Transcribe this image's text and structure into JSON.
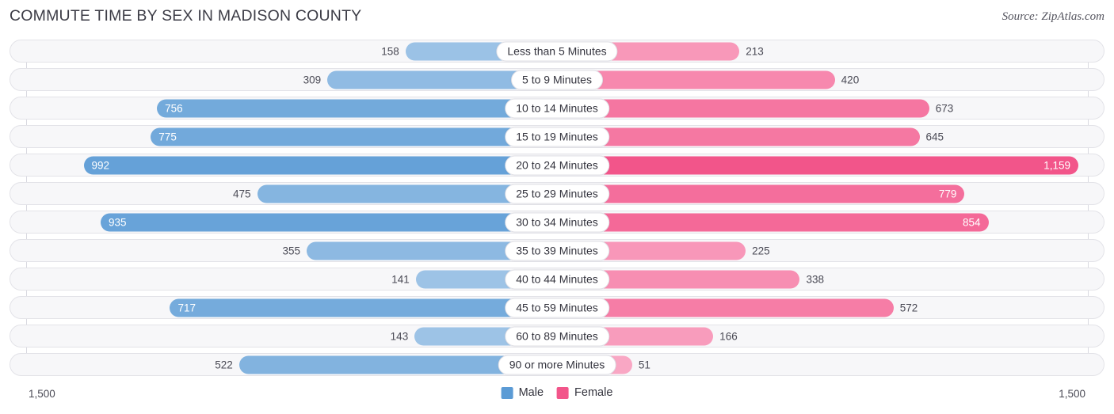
{
  "header": {
    "title": "COMMUTE TIME BY SEX IN MADISON COUNTY",
    "source": "Source: ZipAtlas.com"
  },
  "axis": {
    "left_label": "1,500",
    "right_label": "1,500",
    "max": 1500
  },
  "legend": {
    "male": {
      "label": "Male",
      "color": "#5b9bd5"
    },
    "female": {
      "label": "Female",
      "color": "#f2558a"
    }
  },
  "chart_data": {
    "type": "bar",
    "title": "COMMUTE TIME BY SEX IN MADISON COUNTY",
    "subtitle": "Source: ZipAtlas.com",
    "orientation": "horizontal-diverging",
    "xlabel": "",
    "ylabel": "",
    "xlim": [
      1500,
      1500
    ],
    "grid": false,
    "legend_position": "bottom-center",
    "categories": [
      "Less than 5 Minutes",
      "5 to 9 Minutes",
      "10 to 14 Minutes",
      "15 to 19 Minutes",
      "20 to 24 Minutes",
      "25 to 29 Minutes",
      "30 to 34 Minutes",
      "35 to 39 Minutes",
      "40 to 44 Minutes",
      "45 to 59 Minutes",
      "60 to 89 Minutes",
      "90 or more Minutes"
    ],
    "series": [
      {
        "name": "Male",
        "color": "#5b9bd5",
        "side": "left",
        "values": [
          158,
          309,
          756,
          775,
          992,
          475,
          935,
          355,
          141,
          717,
          143,
          522
        ],
        "labels": [
          "158",
          "309",
          "756",
          "775",
          "992",
          "475",
          "935",
          "355",
          "141",
          "717",
          "143",
          "522"
        ]
      },
      {
        "name": "Female",
        "color": "#f2558a",
        "side": "right",
        "values": [
          213,
          420,
          673,
          645,
          1159,
          779,
          854,
          225,
          338,
          572,
          166,
          51
        ],
        "labels": [
          "213",
          "420",
          "673",
          "645",
          "1,159",
          "779",
          "854",
          "225",
          "338",
          "572",
          "166",
          "51"
        ]
      }
    ]
  },
  "rows": [
    {
      "category": "Less than 5 Minutes",
      "male": 158,
      "male_label": "158",
      "female": 213,
      "female_label": "213"
    },
    {
      "category": "5 to 9 Minutes",
      "male": 309,
      "male_label": "309",
      "female": 420,
      "female_label": "420"
    },
    {
      "category": "10 to 14 Minutes",
      "male": 756,
      "male_label": "756",
      "female": 673,
      "female_label": "673"
    },
    {
      "category": "15 to 19 Minutes",
      "male": 775,
      "male_label": "775",
      "female": 645,
      "female_label": "645"
    },
    {
      "category": "20 to 24 Minutes",
      "male": 992,
      "male_label": "992",
      "female": 1159,
      "female_label": "1,159"
    },
    {
      "category": "25 to 29 Minutes",
      "male": 475,
      "male_label": "475",
      "female": 779,
      "female_label": "779"
    },
    {
      "category": "30 to 34 Minutes",
      "male": 935,
      "male_label": "935",
      "female": 854,
      "female_label": "854"
    },
    {
      "category": "35 to 39 Minutes",
      "male": 355,
      "male_label": "355",
      "female": 225,
      "female_label": "225"
    },
    {
      "category": "40 to 44 Minutes",
      "male": 141,
      "male_label": "141",
      "female": 338,
      "female_label": "338"
    },
    {
      "category": "45 to 59 Minutes",
      "male": 717,
      "male_label": "717",
      "female": 572,
      "female_label": "572"
    },
    {
      "category": "60 to 89 Minutes",
      "male": 143,
      "male_label": "143",
      "female": 166,
      "female_label": "166"
    },
    {
      "category": "90 or more Minutes",
      "male": 522,
      "male_label": "522",
      "female": 51,
      "female_label": "51"
    }
  ]
}
